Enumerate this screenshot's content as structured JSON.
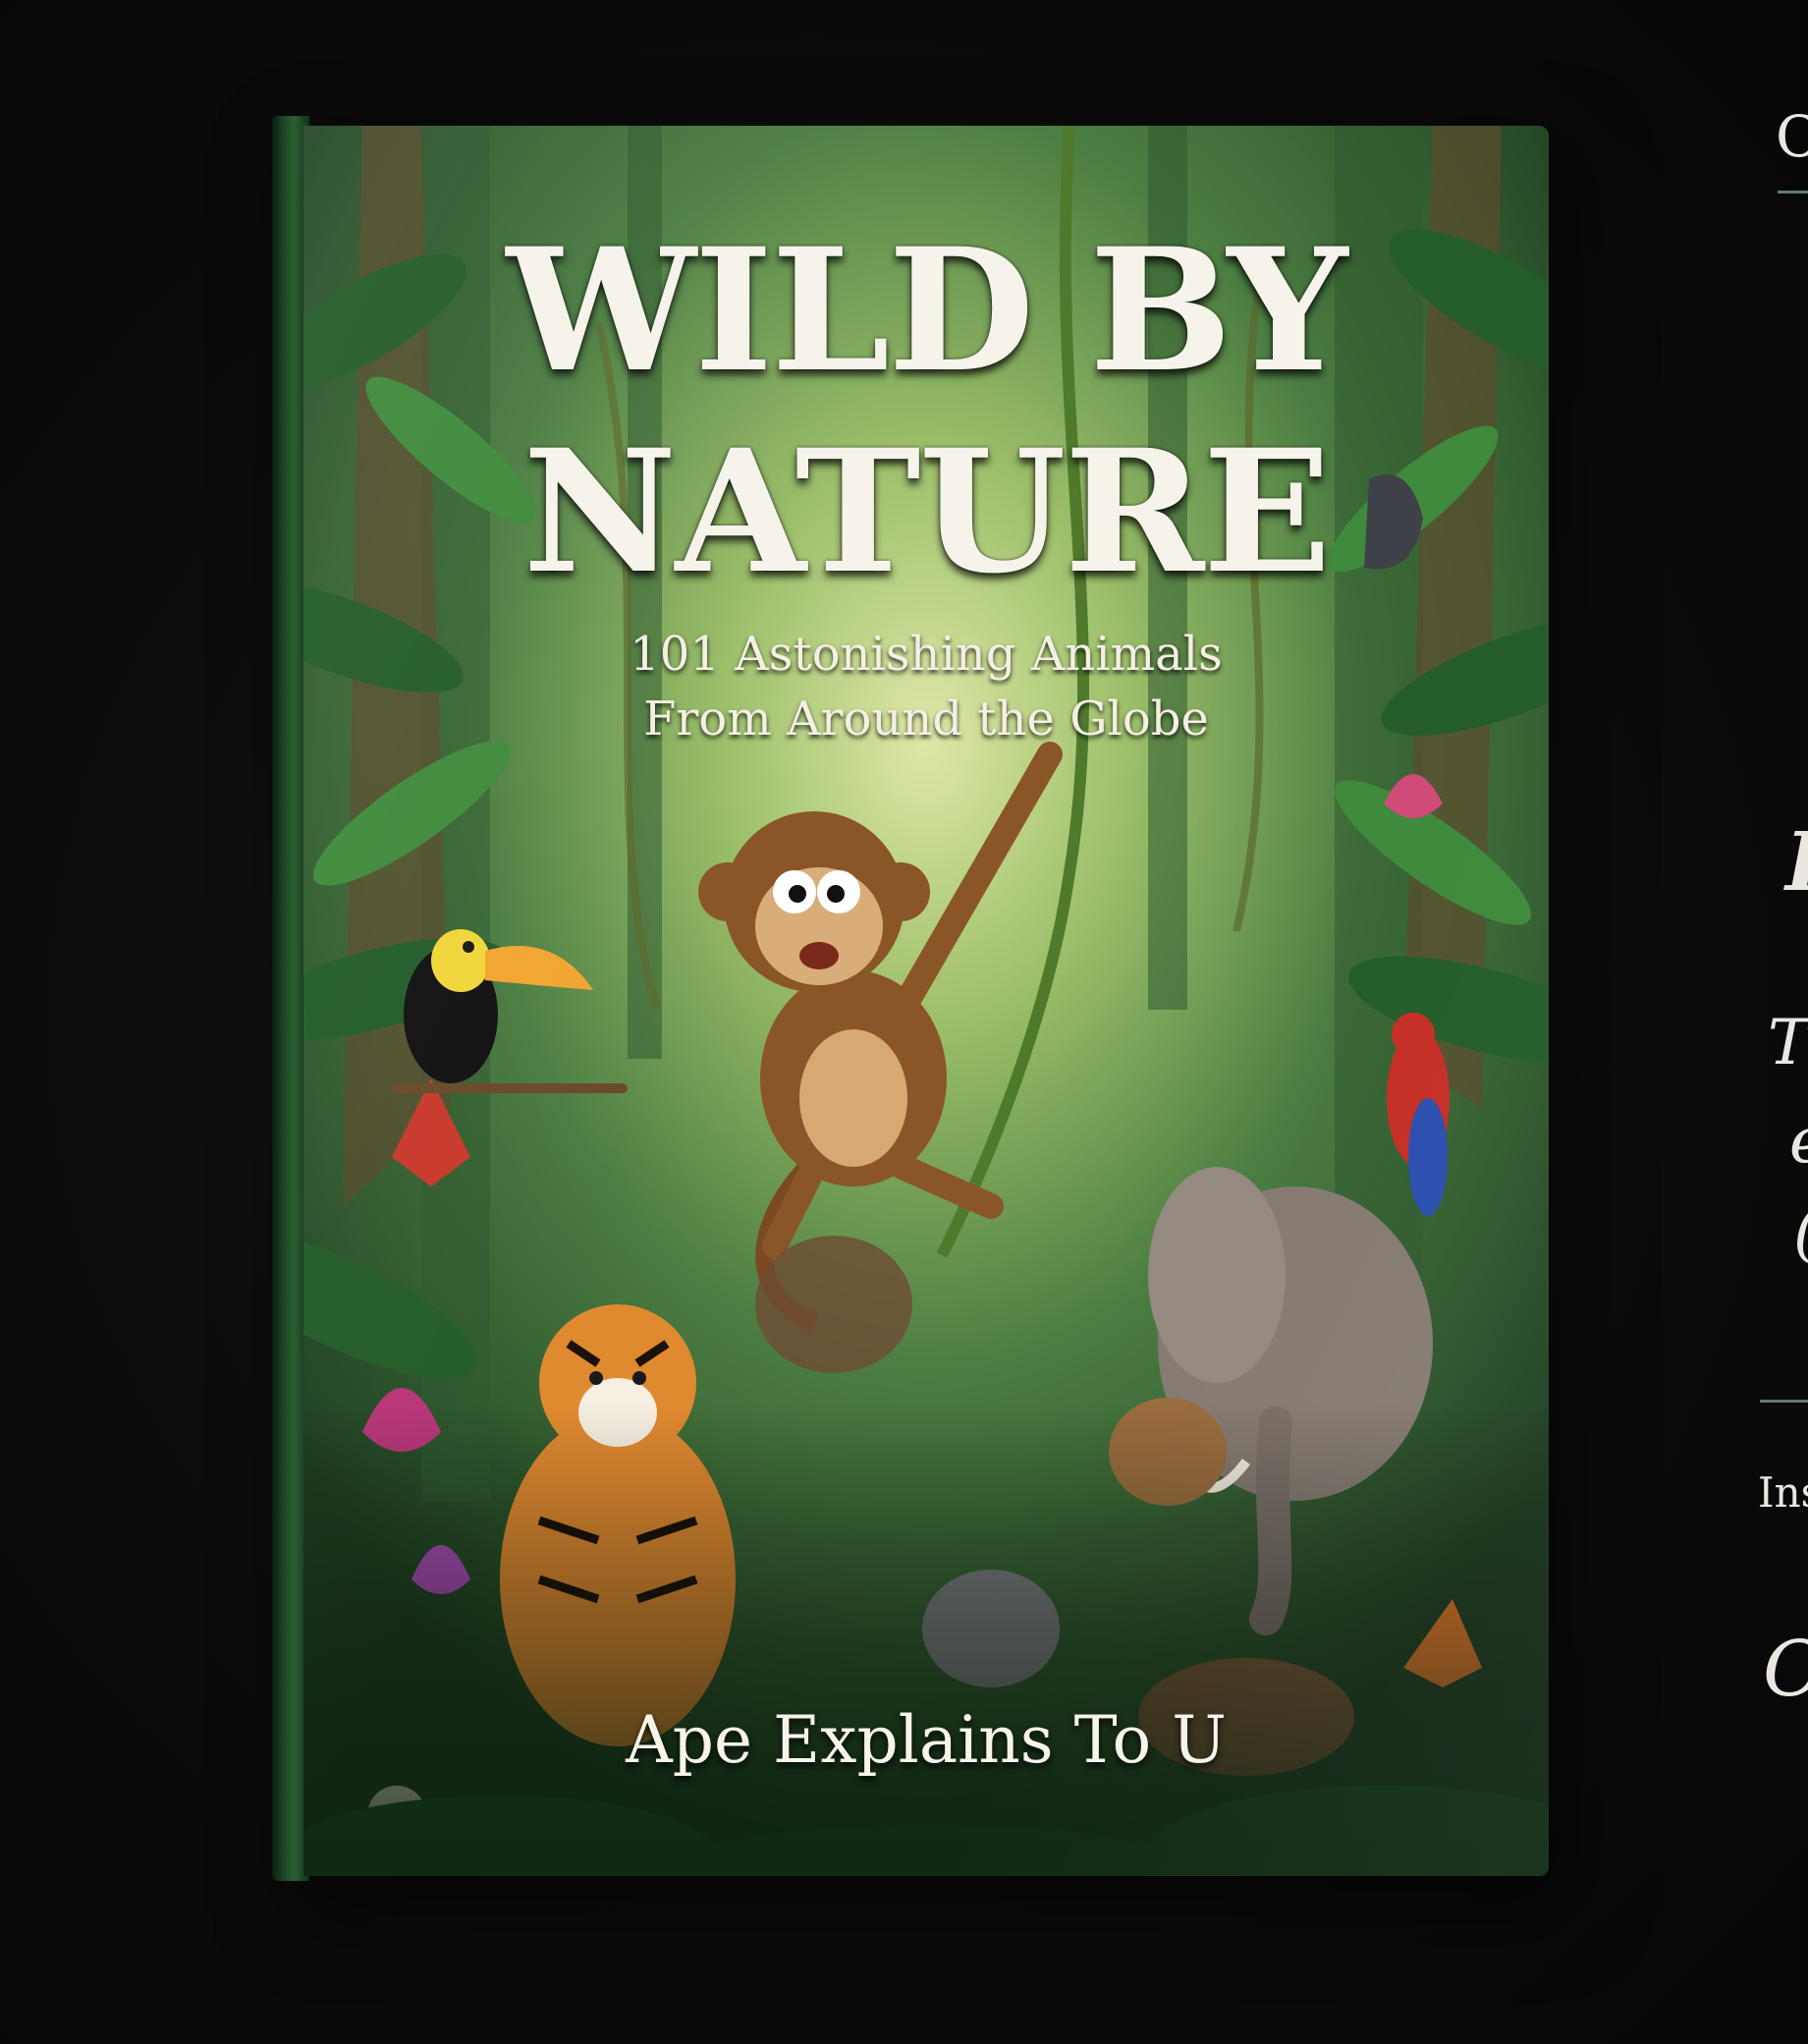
{
  "book": {
    "title_line1": "WILD BY",
    "title_line2": "NATURE",
    "subtitle_line1": "101 Astonishing Animals",
    "subtitle_line2": "From Around the Globe",
    "author": "Ape Explains To U",
    "illustration": [
      "jungle-scene",
      "monkey-on-vine",
      "toucan",
      "tiger",
      "elephant",
      "parrot",
      "tropical-flowers"
    ]
  },
  "side_panel": {
    "top_text": "C",
    "mid_text_1": "I",
    "mid_text_2": "Th",
    "mid_text_3": "e",
    "mid_text_4": "(",
    "bottom_text": "Ins",
    "footer_text": "O"
  },
  "colors": {
    "background": "#080808",
    "cover_green": "#2d5a2e",
    "title_text": "#f6f3ea",
    "rule": "#5e7c72"
  }
}
